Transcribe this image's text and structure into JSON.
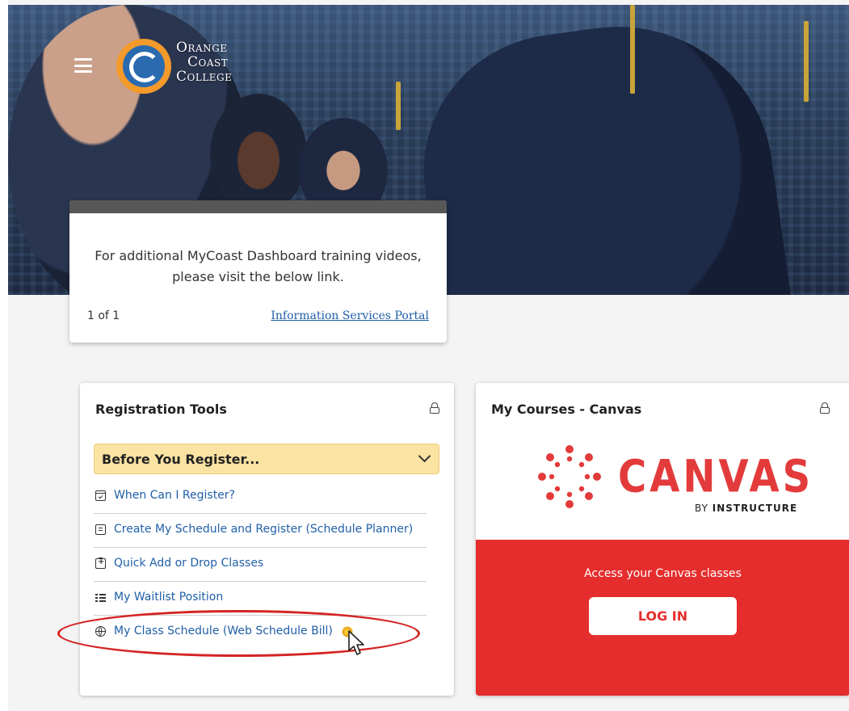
{
  "header": {
    "logo_lines": [
      "Orange",
      "Coast",
      "College"
    ]
  },
  "info_card": {
    "message": "For additional MyCoast Dashboard training videos, please visit the below link.",
    "counter": "1 of 1",
    "link_text": "Information Services Portal"
  },
  "registration_tools": {
    "title": "Registration Tools",
    "accordion_label": "Before You Register...",
    "items": [
      {
        "label": "When Can I Register?",
        "icon": "calendar-check-icon"
      },
      {
        "label": "Create My Schedule and Register (Schedule Planner)",
        "icon": "document-list-icon"
      },
      {
        "label": "Quick Add or Drop Classes",
        "icon": "clipboard-add-icon"
      },
      {
        "label": "My Waitlist Position",
        "icon": "list-icon"
      },
      {
        "label": "My Class Schedule (Web Schedule Bill)",
        "icon": "globe-icon"
      }
    ]
  },
  "canvas": {
    "title": "My Courses - Canvas",
    "brand": "CANVAS",
    "by_prefix": "BY ",
    "by_brand": "INSTRUCTURE",
    "access_text": "Access your Canvas classes",
    "login_label": "LOG IN"
  },
  "colors": {
    "canvas_red": "#e52d2d",
    "accordion_bg": "#fbe3a3",
    "link_blue": "#1f5fa8",
    "annotation_red": "#d42424"
  }
}
